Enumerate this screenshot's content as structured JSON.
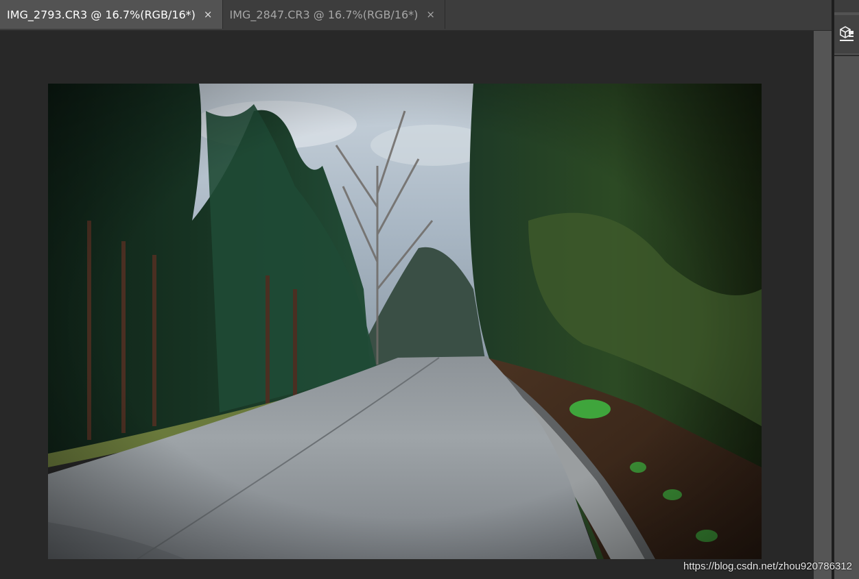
{
  "tabs": [
    {
      "title": "IMG_2793.CR3 @ 16.7%(RGB/16*)",
      "close": "×",
      "active": true
    },
    {
      "title": "IMG_2847.CR3 @ 16.7%(RGB/16*)",
      "close": "×",
      "active": false
    }
  ],
  "right_panel": {
    "icon": "3d-cube-icon"
  },
  "watermark": "https://blog.csdn.net/zhou920786312",
  "colors": {
    "tabbar": "#3d3d3d",
    "active_tab": "#535353",
    "canvas": "#282828",
    "panel": "#535353"
  }
}
